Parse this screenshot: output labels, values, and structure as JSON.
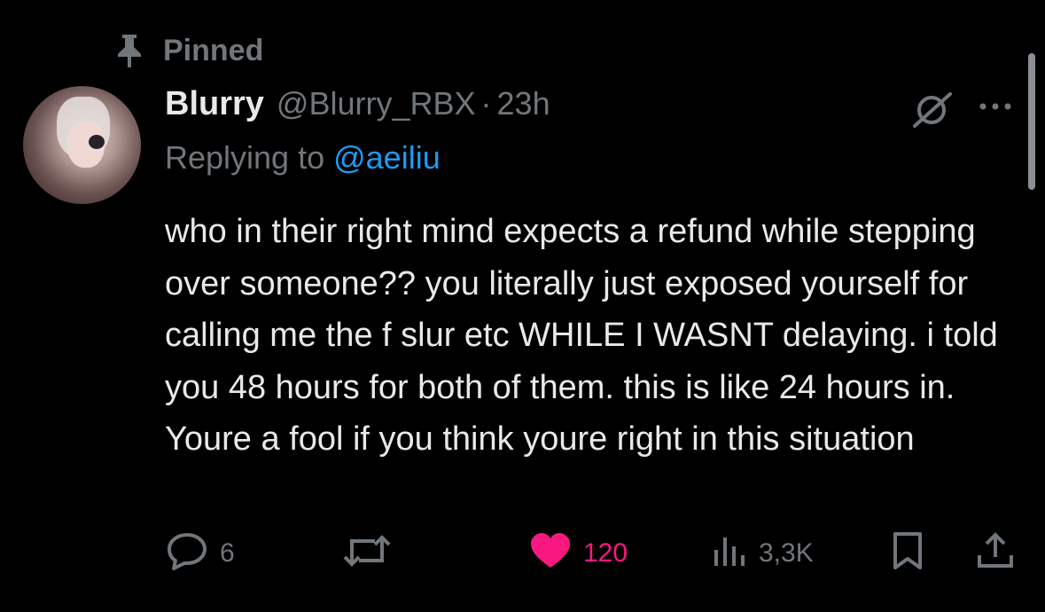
{
  "pinned": {
    "label": "Pinned"
  },
  "tweet": {
    "display_name": "Blurry",
    "handle": "@Blurry_RBX",
    "separator": "·",
    "time": "23h",
    "replying_prefix": "Replying to ",
    "replying_to": "@aeiliu",
    "body": "who in their right mind expects a refund while stepping over someone?? you literally just exposed yourself for calling me the f slur etc WHILE I WASNT delaying. i told you 48 hours for both of them. this is like 24 hours in. Youre a fool if you think youre right in this situation"
  },
  "actions": {
    "replies": "6",
    "likes": "120",
    "views": "3,3K"
  },
  "colors": {
    "background": "#000000",
    "text": "#e7e9ea",
    "muted": "#71767b",
    "link": "#1d9bf0",
    "like": "#f91880"
  },
  "icons": [
    "pin-icon",
    "grok-icon",
    "more-icon",
    "reply-icon",
    "retweet-icon",
    "like-icon",
    "views-icon",
    "bookmark-icon",
    "share-icon"
  ]
}
